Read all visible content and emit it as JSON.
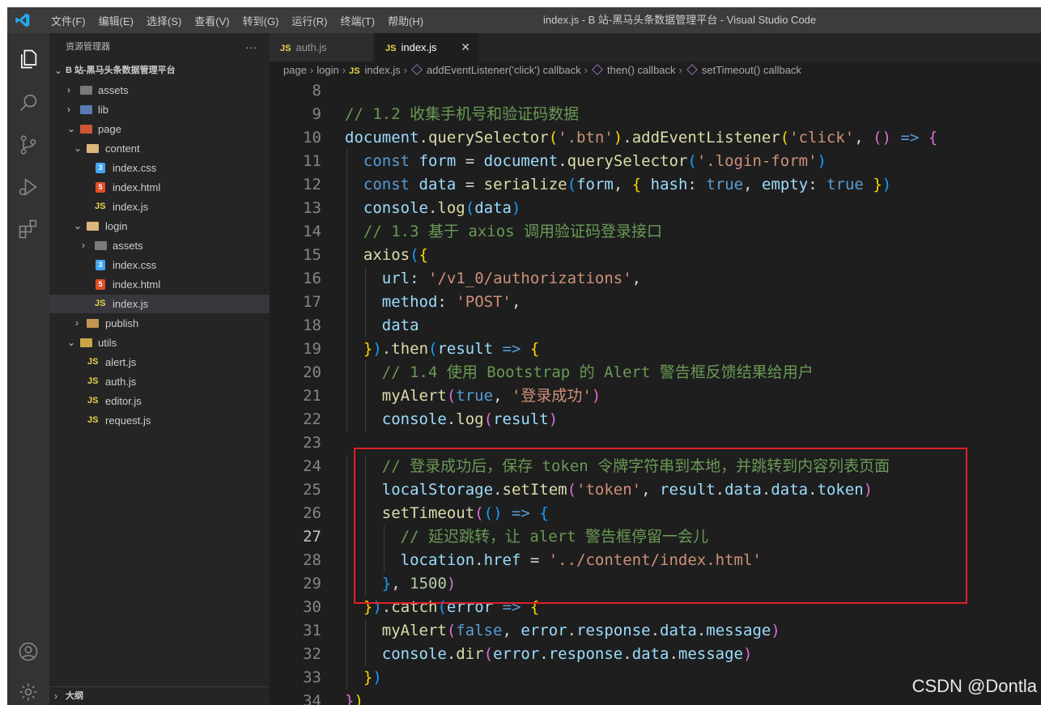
{
  "window": {
    "title": "index.js - B 站-黑马头条数据管理平台 - Visual Studio Code",
    "menu": [
      "文件(F)",
      "编辑(E)",
      "选择(S)",
      "查看(V)",
      "转到(G)",
      "运行(R)",
      "终端(T)",
      "帮助(H)"
    ]
  },
  "activity_bar": {
    "icons": [
      "explorer-icon",
      "search-icon",
      "source-control-icon",
      "run-debug-icon",
      "extensions-icon",
      "account-icon",
      "settings-gear-icon"
    ]
  },
  "sidebar": {
    "header": "资源管理器",
    "more": "···",
    "root": "B 站-黑马头条数据管理平台",
    "tree": [
      {
        "label": "assets",
        "icon": "folder-icon"
      },
      {
        "label": "lib",
        "icon": "folder-icon"
      },
      {
        "label": "page",
        "icon": "folder-icon"
      },
      {
        "label": "content",
        "icon": "folder-icon"
      },
      {
        "label": "index.css",
        "icon": "css-file-icon"
      },
      {
        "label": "index.html",
        "icon": "html-file-icon"
      },
      {
        "label": "index.js",
        "icon": "js-file-icon"
      },
      {
        "label": "login",
        "icon": "folder-icon"
      },
      {
        "label": "assets",
        "icon": "folder-icon"
      },
      {
        "label": "index.css",
        "icon": "css-file-icon"
      },
      {
        "label": "index.html",
        "icon": "html-file-icon"
      },
      {
        "label": "index.js",
        "icon": "js-file-icon"
      },
      {
        "label": "publish",
        "icon": "folder-icon"
      },
      {
        "label": "utils",
        "icon": "folder-icon"
      },
      {
        "label": "alert.js",
        "icon": "js-file-icon"
      },
      {
        "label": "auth.js",
        "icon": "js-file-icon"
      },
      {
        "label": "editor.js",
        "icon": "js-file-icon"
      },
      {
        "label": "request.js",
        "icon": "js-file-icon"
      }
    ],
    "outline": "大纲",
    "js_badge": "JS"
  },
  "editor": {
    "tabs": [
      {
        "label": "auth.js",
        "active": false
      },
      {
        "label": "index.js",
        "active": true
      }
    ],
    "tab_close": "✕",
    "breadcrumb": [
      "page",
      "login",
      "index.js",
      "addEventListener('click') callback",
      "then() callback",
      "setTimeout() callback"
    ],
    "current_line": 27,
    "line_numbers": [
      "8",
      "9",
      "10",
      "11",
      "12",
      "13",
      "14",
      "15",
      "16",
      "17",
      "18",
      "19",
      "20",
      "21",
      "22",
      "23",
      "24",
      "25",
      "26",
      "27",
      "28",
      "29",
      "30",
      "31",
      "32",
      "33",
      "34"
    ],
    "code_lines": [
      "",
      "// 1.2 收集手机号和验证码数据",
      "document.querySelector('.btn').addEventListener('click', () => {",
      "  const form = document.querySelector('.login-form')",
      "  const data = serialize(form, { hash: true, empty: true })",
      "  console.log(data)",
      "  // 1.3 基于 axios 调用验证码登录接口",
      "  axios({",
      "    url: '/v1_0/authorizations',",
      "    method: 'POST',",
      "    data",
      "  }).then(result => {",
      "    // 1.4 使用 Bootstrap 的 Alert 警告框反馈结果给用户",
      "    myAlert(true, '登录成功')",
      "    console.log(result)",
      "",
      "    // 登录成功后，保存 token 令牌字符串到本地，并跳转到内容列表页面",
      "    localStorage.setItem('token', result.data.data.token)",
      "    setTimeout(() => {",
      "      // 延迟跳转，让 alert 警告框停留一会儿",
      "      location.href = '../content/index.html'",
      "    }, 1500)",
      "  }).catch(error => {",
      "    myAlert(false, error.response.data.message)",
      "    console.dir(error.response.data.message)",
      "  })",
      "})"
    ]
  },
  "watermark": "CSDN @Dontla",
  "colors": {
    "highlight_box": "#e0202a",
    "editor_bg": "#1e1e1e",
    "sidebar_bg": "#252526",
    "activity_bg": "#333333",
    "titlebar_bg": "#3c3c3c"
  }
}
